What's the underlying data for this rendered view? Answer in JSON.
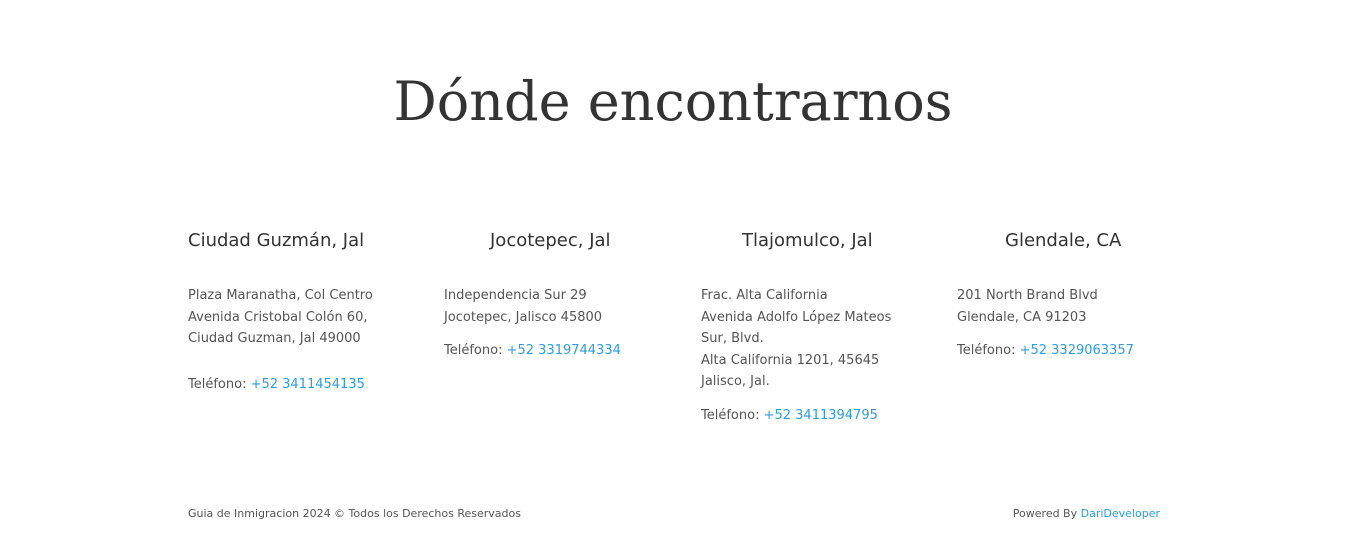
{
  "section": {
    "title": "Dónde encontrarnos"
  },
  "locations": [
    {
      "name": "Ciudad Guzmán, Jal",
      "address": [
        "Plaza Maranatha, Col Centro",
        "Avenida Cristobal Colón 60,",
        "Ciudad Guzman, Jal 49000"
      ],
      "phone_label": "Teléfono:",
      "phone": "+52 3411454135"
    },
    {
      "name": "Jocotepec, Jal",
      "address": [
        "Independencia Sur 29",
        "Jocotepec, Jalisco 45800"
      ],
      "phone_label": "Teléfono:",
      "phone": "+52 3319744334"
    },
    {
      "name": "Tlajomulco, Jal",
      "address": [
        "Frac. Alta California",
        "Avenida Adolfo López Mateos Sur, Blvd.",
        "Alta California 1201, 45645 Jalisco, Jal."
      ],
      "phone_label": "Teléfono:",
      "phone": "+52 3411394795"
    },
    {
      "name": "Glendale, CA",
      "address": [
        "201 North Brand Blvd",
        "Glendale, CA 91203"
      ],
      "phone_label": "Teléfono:",
      "phone": "+52 3329063357"
    }
  ],
  "footer": {
    "copyright": "Guia de Inmigracion 2024 © Todos los Derechos Reservados",
    "powered_by": "Powered By",
    "developer": "DariDeveloper"
  },
  "colors": {
    "link": "#2c9ee0",
    "heading": "#333333",
    "text": "#555555"
  }
}
